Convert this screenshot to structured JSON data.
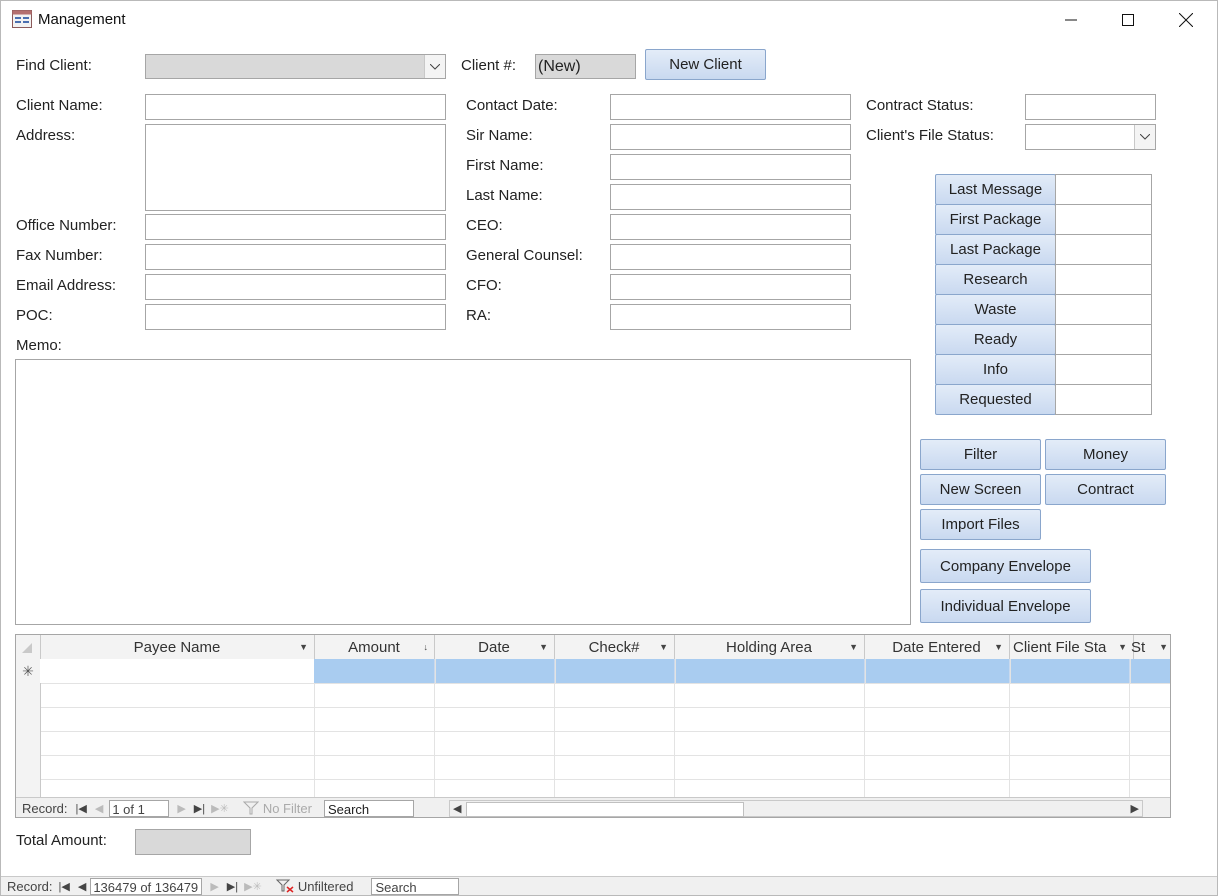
{
  "window": {
    "title": "Management"
  },
  "top": {
    "find_client_label": "Find Client:",
    "client_num_label": "Client #:",
    "client_num_value": "(New)",
    "new_client_button": "New Client"
  },
  "left_fields": {
    "client_name": "Client Name:",
    "address": "Address:",
    "office_number": "Office Number:",
    "fax_number": "Fax Number:",
    "email_address": "Email Address:",
    "poc": "POC:"
  },
  "mid_fields": {
    "contact_date": "Contact Date:",
    "sir_name": "Sir Name:",
    "first_name": "First Name:",
    "last_name": "Last Name:",
    "ceo": "CEO:",
    "general_counsel": "General Counsel:",
    "cfo": "CFO:",
    "ra": "RA:"
  },
  "right_fields": {
    "contract_status": "Contract Status:",
    "file_status": "Client's File Status:"
  },
  "memo_label": "Memo:",
  "status_buttons": [
    "Last Message",
    "First Package",
    "Last Package",
    "Research",
    "Waste",
    "Ready",
    "Info",
    "Requested"
  ],
  "action_buttons": {
    "filter": "Filter",
    "money": "Money",
    "new_screen": "New Screen",
    "contract": "Contract",
    "import_files": "Import Files",
    "company_envelope": "Company Envelope",
    "individual_envelope": "Individual Envelope"
  },
  "datasheet": {
    "columns": [
      "Payee Name",
      "Amount",
      "Date",
      "Check#",
      "Holding Area",
      "Date Entered",
      "Client File Sta",
      "St"
    ],
    "new_row_marker": "✳",
    "nav": {
      "record_label": "Record:",
      "position": "1 of 1",
      "filter_label": "No Filter",
      "search": "Search"
    }
  },
  "total": {
    "label": "Total Amount:"
  },
  "form_nav": {
    "record_label": "Record:",
    "position": "136479 of 136479",
    "filter_label": "Unfiltered",
    "search": "Search"
  },
  "colors": {
    "button_top": "#e3ecf8",
    "button_bottom": "#c9d9f0",
    "row_highlight": "#a9ccf0"
  }
}
